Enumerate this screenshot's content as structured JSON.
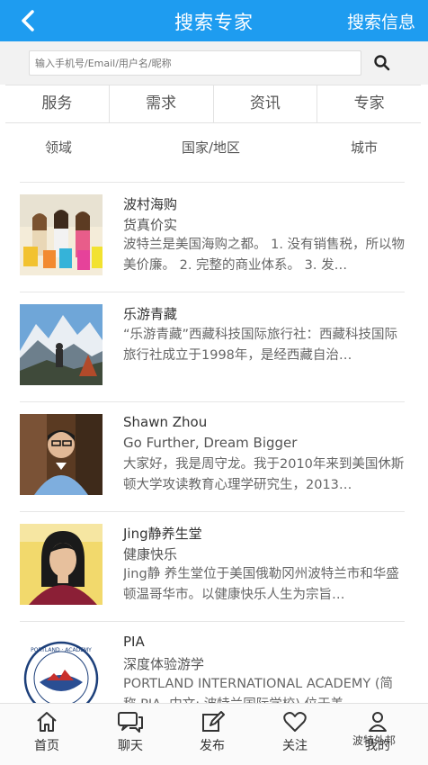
{
  "header": {
    "title": "搜索专家",
    "right_action": "搜索信息"
  },
  "search": {
    "placeholder": "输入手机号/Email/用户名/昵称"
  },
  "tabs": [
    "服务",
    "需求",
    "资讯",
    "专家"
  ],
  "filters": [
    "领域",
    "国家/地区",
    "城市"
  ],
  "items": [
    {
      "name": "波村海购",
      "subtitle": "货真价实",
      "desc": "波特兰是美国海购之都。 1. 没有销售税，所以物美价廉。 2. 完整的商业体系。 3. 发…"
    },
    {
      "name": "乐游青藏",
      "subtitle": "",
      "desc": "“乐游青藏”西藏科技国际旅行社：西藏科技国际旅行社成立于1998年，是经西藏自治…"
    },
    {
      "name": "Shawn Zhou",
      "subtitle": "Go Further, Dream Bigger",
      "desc": "大家好，我是周守龙。我于2010年来到美国休斯顿大学攻读教育心理学研究生，2013…"
    },
    {
      "name": "Jing静养生堂",
      "subtitle": "健康快乐",
      "desc": "Jing静 养生堂位于美国俄勒冈州波特兰市和华盛顿温哥华市。以健康快乐人生为宗旨…"
    },
    {
      "name": "PIA",
      "subtitle": "深度体验游学",
      "desc": "PORTLAND INTERNATIONAL ACADEMY (简称 PIA, 中文: 波特兰国际学校) 位于美…",
      "logo_text": "PORTLAND INTERNATIONAL ACADEMY"
    }
  ],
  "bottom_nav": [
    {
      "label": "首页",
      "icon": "home-icon"
    },
    {
      "label": "聊天",
      "icon": "chat-icon"
    },
    {
      "label": "发布",
      "icon": "edit-icon"
    },
    {
      "label": "关注",
      "icon": "heart-icon"
    },
    {
      "label": "我的",
      "icon": "user-icon"
    }
  ],
  "watermark": "波特外邦",
  "colors": {
    "header": "#1e9cf0"
  }
}
